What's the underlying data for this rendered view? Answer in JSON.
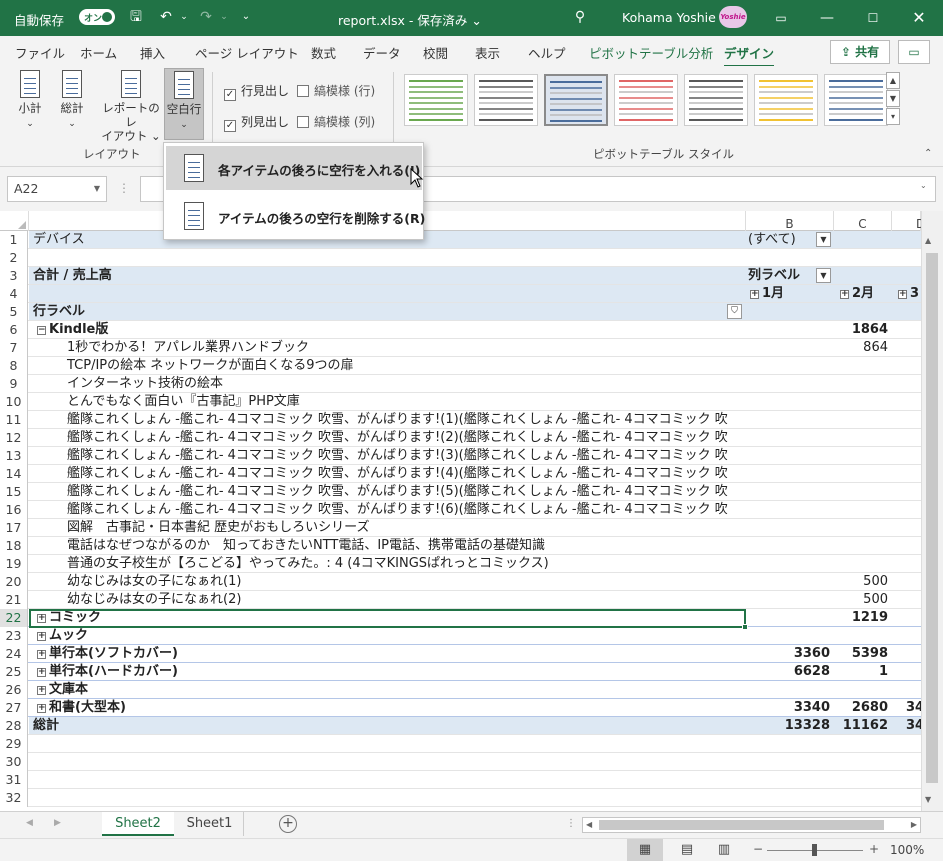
{
  "titlebar": {
    "autosave_label": "自動保存",
    "autosave_state": "オン",
    "doc_title": "report.xlsx - 保存済み ⌄",
    "user_name": "Kohama Yoshie",
    "avatar_text": "Yoshie"
  },
  "tabs": [
    "ファイル",
    "ホーム",
    "挿入",
    "ページ レイアウト",
    "数式",
    "データ",
    "校閲",
    "表示",
    "ヘルプ",
    "ピボットテーブル分析",
    "デザイン"
  ],
  "share_label": "共有",
  "ribbon": {
    "subtotal": "小計",
    "grandtotal": "総計",
    "report_layout_1": "レポートのレ",
    "report_layout_2": "イアウト ⌄",
    "blank_rows": "空白行",
    "row_headers": "行見出し",
    "col_headers": "列見出し",
    "banded_rows": "縞模様 (行)",
    "banded_cols": "縞模様 (列)",
    "group_layout": "レイアウト",
    "group_styles": "ピボットテーブル スタイル"
  },
  "style_colors": [
    "#6aa84f",
    "#595959",
    "#4a6c9b",
    "#e06666",
    "#595959",
    "#f1c232",
    "#4a6c9b"
  ],
  "namebox": "A22",
  "menu": {
    "insert_blank": "各アイテムの後ろに空行を入れる(I)",
    "remove_blank": "アイテムの後ろの空行を削除する(R)"
  },
  "columns": [
    "B",
    "C",
    "D"
  ],
  "rows": [
    {
      "n": "1",
      "a": "デバイス",
      "b": "(すべて)",
      "c": "",
      "d": "",
      "style": "hl"
    },
    {
      "n": "2",
      "a": "",
      "b": "",
      "c": "",
      "d": ""
    },
    {
      "n": "3",
      "a": "合計 / 売上高",
      "b": "列ラベル",
      "c": "",
      "d": "",
      "style": "hlb"
    },
    {
      "n": "4",
      "a": "",
      "b": "1月",
      "c": "2月",
      "d": "3",
      "style": "hlb"
    },
    {
      "n": "5",
      "a": "行ラベル",
      "b": "",
      "c": "",
      "d": "",
      "style": "hlb"
    },
    {
      "n": "6",
      "a": "Kindle版",
      "b": "",
      "c": "1864",
      "d": "",
      "style": "bold"
    },
    {
      "n": "7",
      "a": "1秒でわかる！アパレル業界ハンドブック",
      "b": "",
      "c": "864",
      "d": ""
    },
    {
      "n": "8",
      "a": "TCP/IPの絵本 ネットワークが面白くなる9つの扉",
      "b": "",
      "c": "",
      "d": ""
    },
    {
      "n": "9",
      "a": "インターネット技術の絵本",
      "b": "",
      "c": "",
      "d": ""
    },
    {
      "n": "10",
      "a": "とんでもなく面白い『古事記』PHP文庫",
      "b": "",
      "c": "",
      "d": ""
    },
    {
      "n": "11",
      "a": "艦隊これくしょん -艦これ- 4コマコミック 吹雪、がんばります!(1)(艦隊これくしょん -艦これ- 4コマコミック 吹",
      "b": "",
      "c": "",
      "d": ""
    },
    {
      "n": "12",
      "a": "艦隊これくしょん -艦これ- 4コマコミック 吹雪、がんばります!(2)(艦隊これくしょん -艦これ- 4コマコミック 吹",
      "b": "",
      "c": "",
      "d": ""
    },
    {
      "n": "13",
      "a": "艦隊これくしょん -艦これ- 4コマコミック 吹雪、がんばります!(3)(艦隊これくしょん -艦これ- 4コマコミック 吹",
      "b": "",
      "c": "",
      "d": ""
    },
    {
      "n": "14",
      "a": "艦隊これくしょん -艦これ- 4コマコミック 吹雪、がんばります!(4)(艦隊これくしょん -艦これ- 4コマコミック 吹",
      "b": "",
      "c": "",
      "d": ""
    },
    {
      "n": "15",
      "a": "艦隊これくしょん -艦これ- 4コマコミック 吹雪、がんばります!(5)(艦隊これくしょん -艦これ- 4コマコミック 吹",
      "b": "",
      "c": "",
      "d": ""
    },
    {
      "n": "16",
      "a": "艦隊これくしょん -艦これ- 4コマコミック 吹雪、がんばります!(6)(艦隊これくしょん -艦これ- 4コマコミック 吹",
      "b": "",
      "c": "",
      "d": ""
    },
    {
      "n": "17",
      "a": "図解　古事記・日本書紀 歴史がおもしろいシリーズ",
      "b": "",
      "c": "",
      "d": ""
    },
    {
      "n": "18",
      "a": "電話はなぜつながるのか　知っておきたいNTT電話、IP電話、携帯電話の基礎知識",
      "b": "",
      "c": "",
      "d": ""
    },
    {
      "n": "19",
      "a": "普通の女子校生が【ろこどる】やってみた。: 4 (4コマKINGSぱれっとコミックス)",
      "b": "",
      "c": "",
      "d": ""
    },
    {
      "n": "20",
      "a": "幼なじみは女の子になぁれ(1)",
      "b": "",
      "c": "500",
      "d": ""
    },
    {
      "n": "21",
      "a": "幼なじみは女の子になぁれ(2)",
      "b": "",
      "c": "500",
      "d": ""
    },
    {
      "n": "22",
      "a": "コミック",
      "b": "",
      "c": "1219",
      "d": "",
      "style": "bold"
    },
    {
      "n": "23",
      "a": "ムック",
      "b": "",
      "c": "",
      "d": "",
      "style": "bold"
    },
    {
      "n": "24",
      "a": "単行本(ソフトカバー)",
      "b": "3360",
      "c": "5398",
      "d": "",
      "style": "bold"
    },
    {
      "n": "25",
      "a": "単行本(ハードカバー)",
      "b": "6628",
      "c": "1",
      "d": "",
      "style": "bold"
    },
    {
      "n": "26",
      "a": "文庫本",
      "b": "",
      "c": "",
      "d": "",
      "style": "bold"
    },
    {
      "n": "27",
      "a": "和書(大型本)",
      "b": "3340",
      "c": "2680",
      "d": "34",
      "style": "bold"
    },
    {
      "n": "28",
      "a": "総計",
      "b": "13328",
      "c": "11162",
      "d": "34",
      "style": "hlb"
    },
    {
      "n": "29",
      "a": "",
      "b": "",
      "c": "",
      "d": ""
    },
    {
      "n": "30",
      "a": "",
      "b": "",
      "c": "",
      "d": ""
    },
    {
      "n": "31",
      "a": "",
      "b": "",
      "c": "",
      "d": ""
    },
    {
      "n": "32",
      "a": "",
      "b": "",
      "c": "",
      "d": ""
    }
  ],
  "sheets": [
    "Sheet2",
    "Sheet1"
  ],
  "zoom": "100%"
}
